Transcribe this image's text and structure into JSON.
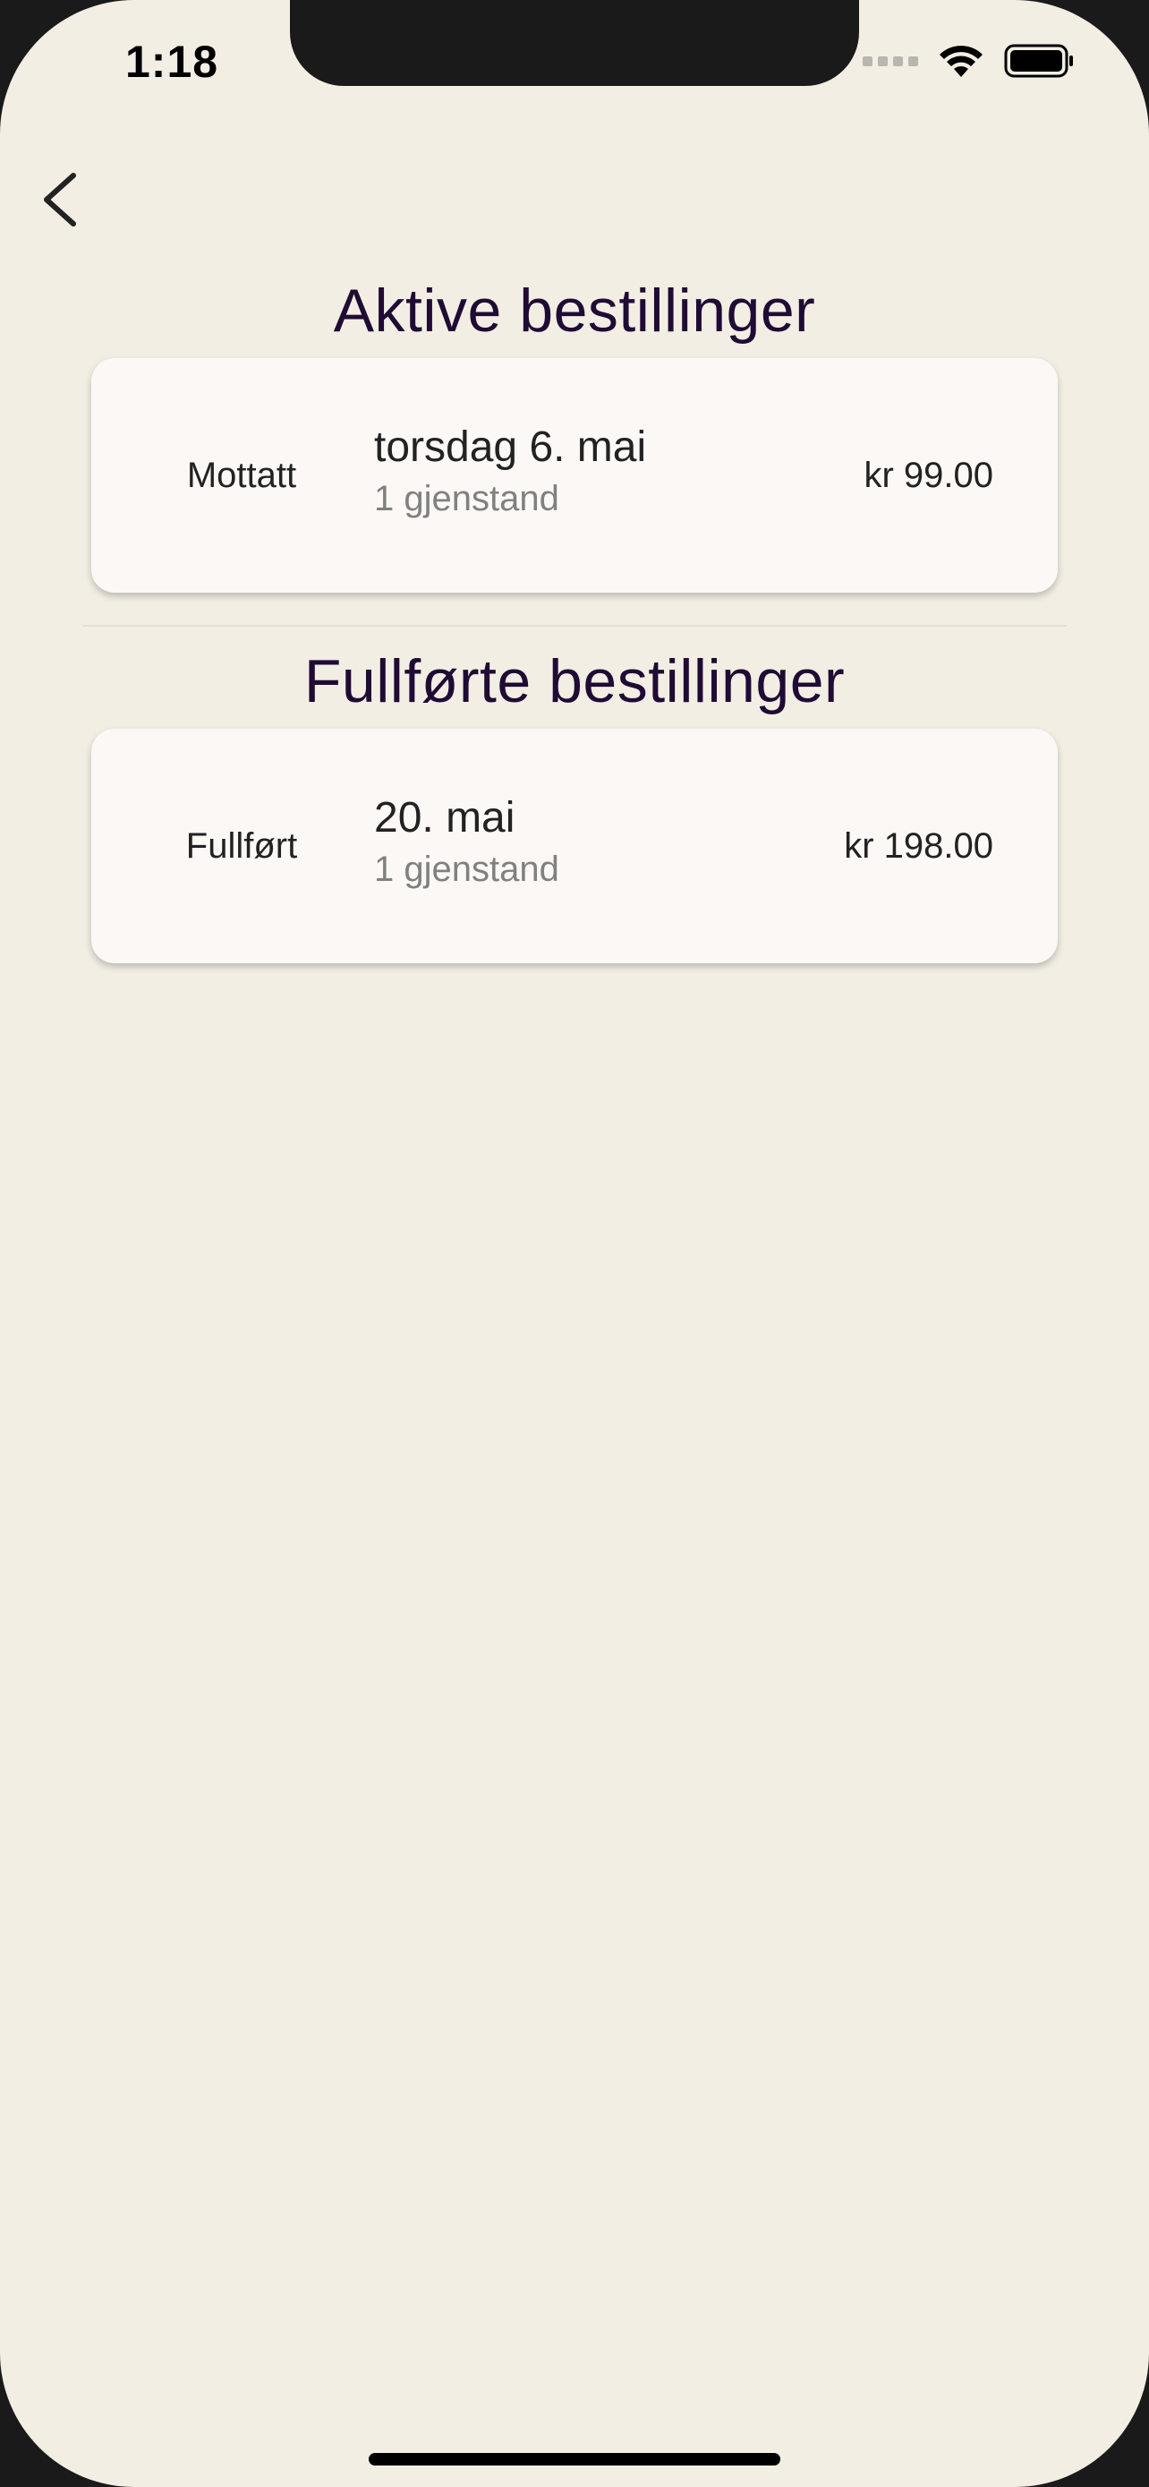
{
  "status_bar": {
    "time": "1:18"
  },
  "nav": {
    "back_icon": "chevron-left-icon"
  },
  "active_section": {
    "title": "Aktive bestillinger",
    "orders": [
      {
        "status": "Mottatt",
        "date": "torsdag 6. mai",
        "items": "1 gjenstand",
        "price": "kr 99.00"
      }
    ]
  },
  "completed_section": {
    "title": "Fullførte bestillinger",
    "orders": [
      {
        "status": "Fullført",
        "date": "20. mai",
        "items": "1 gjenstand",
        "price": "kr 198.00"
      }
    ]
  },
  "colors": {
    "background": "#f2eee4",
    "card": "#fcf8f5",
    "title": "#1f0b33",
    "secondary_text": "#808080"
  }
}
